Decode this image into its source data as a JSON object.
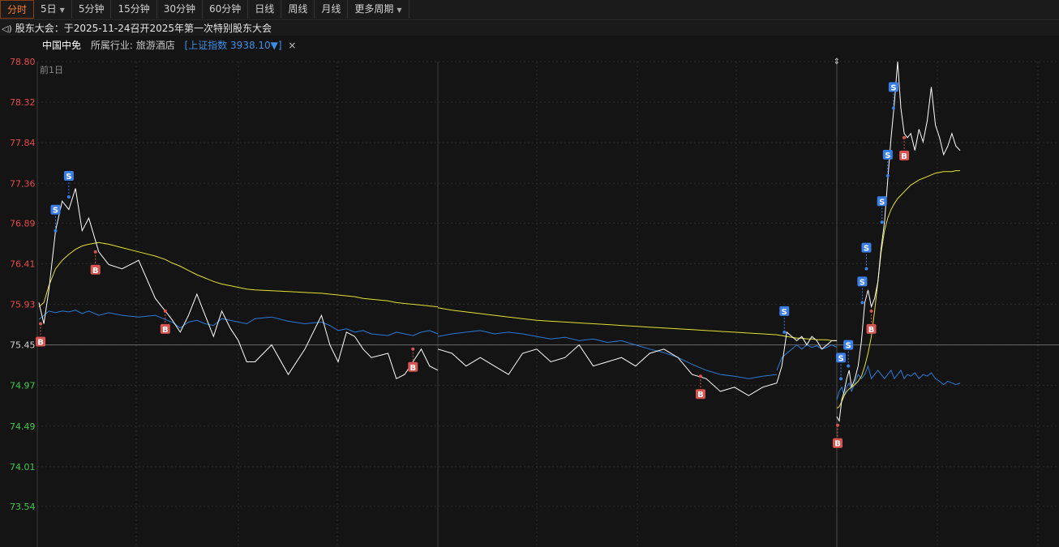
{
  "tabs": [
    {
      "label": "分时",
      "active": true,
      "dropdown": false
    },
    {
      "label": "5日",
      "active": false,
      "dropdown": true
    },
    {
      "label": "5分钟",
      "active": false,
      "dropdown": false
    },
    {
      "label": "15分钟",
      "active": false,
      "dropdown": false
    },
    {
      "label": "30分钟",
      "active": false,
      "dropdown": false
    },
    {
      "label": "60分钟",
      "active": false,
      "dropdown": false
    },
    {
      "label": "日线",
      "active": false,
      "dropdown": false
    },
    {
      "label": "周线",
      "active": false,
      "dropdown": false
    },
    {
      "label": "月线",
      "active": false,
      "dropdown": false
    },
    {
      "label": "更多周期",
      "active": false,
      "dropdown": true
    }
  ],
  "notice": {
    "icon": "speaker-icon",
    "text": "股东大会：于2025-11-24召开2025年第一次特别股东大会"
  },
  "info": {
    "name": "中国中免",
    "industry_label": "所属行业: ",
    "industry": "旅游酒店",
    "index": "[上证指数 3938.10▼]",
    "close": "×"
  },
  "colors": {
    "price": "#ffffff",
    "avg": "#e6e032",
    "index": "#2a7bd8",
    "up": "#e84a4a",
    "down": "#3ec94e",
    "ref": "#d0d0d0",
    "buy": "#d9534f",
    "sell": "#3a7ee6",
    "grid": "#2b2b2b"
  },
  "chart_data": {
    "type": "line",
    "period_label": "前1日",
    "ref_price": 75.45,
    "ylim": [
      73.06,
      78.8
    ],
    "y_ticks": [
      "78.80",
      "78.32",
      "77.84",
      "77.36",
      "76.89",
      "76.41",
      "75.93",
      "75.45",
      "74.97",
      "74.49",
      "74.01",
      "73.54"
    ],
    "day1": {
      "x": [
        0,
        3,
        6,
        10,
        14,
        18,
        22,
        26,
        30,
        36,
        42,
        50,
        60,
        70,
        76,
        80,
        85,
        90,
        95,
        100,
        105,
        110,
        115,
        120,
        125,
        130,
        140,
        150,
        160,
        170,
        175,
        180,
        185,
        190,
        195,
        200,
        210,
        215,
        220,
        225,
        230,
        235,
        240
      ],
      "price": [
        75.95,
        75.7,
        76.1,
        76.8,
        77.15,
        77.05,
        77.3,
        76.8,
        76.95,
        76.55,
        76.4,
        76.35,
        76.45,
        76.0,
        75.85,
        75.75,
        75.6,
        75.8,
        76.05,
        75.8,
        75.55,
        75.85,
        75.65,
        75.5,
        75.25,
        75.25,
        75.45,
        75.1,
        75.4,
        75.8,
        75.45,
        75.25,
        75.6,
        75.55,
        75.4,
        75.3,
        75.35,
        75.05,
        75.1,
        75.25,
        75.4,
        75.2,
        75.15
      ],
      "avg": [
        75.9,
        75.95,
        76.15,
        76.35,
        76.45,
        76.52,
        76.58,
        76.62,
        76.64,
        76.66,
        76.64,
        76.6,
        76.55,
        76.5,
        76.46,
        76.42,
        76.38,
        76.33,
        76.28,
        76.24,
        76.2,
        76.17,
        76.15,
        76.13,
        76.11,
        76.1,
        76.09,
        76.08,
        76.07,
        76.06,
        76.05,
        76.04,
        76.03,
        76.02,
        76.0,
        75.99,
        75.97,
        75.95,
        75.94,
        75.93,
        75.92,
        75.91,
        75.9
      ],
      "index": [
        75.75,
        75.8,
        75.85,
        75.83,
        75.85,
        75.84,
        75.86,
        75.82,
        75.85,
        75.8,
        75.83,
        75.8,
        75.78,
        75.8,
        75.75,
        75.72,
        75.65,
        75.72,
        75.74,
        75.7,
        75.68,
        75.76,
        75.74,
        75.72,
        75.7,
        75.76,
        75.78,
        75.73,
        75.7,
        75.72,
        75.68,
        75.62,
        75.64,
        75.6,
        75.62,
        75.58,
        75.56,
        75.6,
        75.58,
        75.56,
        75.6,
        75.62,
        75.58
      ]
    },
    "day1b": {
      "x": [
        0,
        10,
        20,
        30,
        40,
        50,
        60,
        70,
        80,
        90,
        100,
        110,
        120,
        130,
        140,
        150,
        160,
        170,
        180,
        190,
        200,
        210,
        220,
        230,
        240
      ],
      "price": [
        75.4,
        75.35,
        75.2,
        75.3,
        75.2,
        75.1,
        75.35,
        75.4,
        75.25,
        75.3,
        75.45,
        75.2,
        75.25,
        75.3,
        75.2,
        75.35,
        75.4,
        75.3,
        75.1,
        75.05,
        74.9,
        74.95,
        74.85,
        74.95,
        75.0
      ],
      "avg": [
        75.89,
        75.86,
        75.84,
        75.82,
        75.8,
        75.78,
        75.76,
        75.74,
        75.73,
        75.72,
        75.71,
        75.7,
        75.69,
        75.68,
        75.67,
        75.66,
        75.65,
        75.64,
        75.63,
        75.62,
        75.61,
        75.6,
        75.59,
        75.58,
        75.57
      ],
      "index": [
        75.55,
        75.58,
        75.6,
        75.62,
        75.58,
        75.6,
        75.58,
        75.55,
        75.52,
        75.54,
        75.5,
        75.52,
        75.48,
        75.5,
        75.45,
        75.4,
        75.36,
        75.3,
        75.22,
        75.15,
        75.1,
        75.08,
        75.05,
        75.08,
        75.1
      ]
    },
    "day1c": {
      "x": [
        0,
        10,
        20,
        30,
        40,
        50,
        60,
        70,
        80,
        90,
        100,
        110,
        120
      ],
      "price": [
        75.0,
        75.2,
        75.6,
        75.55,
        75.5,
        75.55,
        75.45,
        75.55,
        75.5,
        75.4,
        75.45,
        75.5,
        75.5
      ],
      "avg": [
        75.57,
        75.56,
        75.55,
        75.54,
        75.53,
        75.53,
        75.52,
        75.52,
        75.51,
        75.51,
        75.51,
        75.5,
        75.5
      ],
      "index": [
        75.15,
        75.3,
        75.35,
        75.4,
        75.45,
        75.4,
        75.45,
        75.42,
        75.44,
        75.4,
        75.42,
        75.45,
        75.42
      ]
    },
    "day2": {
      "x": [
        0,
        3,
        6,
        9,
        12,
        15,
        18,
        22,
        26,
        30,
        34,
        38,
        42,
        46,
        50,
        54,
        58,
        62,
        66,
        70,
        74,
        78,
        82,
        86,
        90,
        95,
        100,
        105,
        110,
        115,
        120,
        125,
        130,
        135,
        140,
        145,
        150
      ],
      "price": [
        74.6,
        74.55,
        74.8,
        74.9,
        75.05,
        75.15,
        74.95,
        75.05,
        75.2,
        75.5,
        75.95,
        76.1,
        75.9,
        76.0,
        76.2,
        76.6,
        76.9,
        77.4,
        77.9,
        78.3,
        78.8,
        78.25,
        77.95,
        77.9,
        77.95,
        77.75,
        78.0,
        77.85,
        78.1,
        78.5,
        78.05,
        77.9,
        77.7,
        77.8,
        77.95,
        77.8,
        77.75
      ],
      "avg": [
        74.7,
        74.72,
        74.78,
        74.85,
        74.9,
        74.93,
        74.95,
        74.98,
        75.02,
        75.08,
        75.2,
        75.35,
        75.55,
        75.85,
        76.2,
        76.55,
        76.8,
        76.95,
        77.05,
        77.12,
        77.18,
        77.22,
        77.26,
        77.3,
        77.34,
        77.37,
        77.4,
        77.42,
        77.44,
        77.46,
        77.48,
        77.49,
        77.5,
        77.5,
        77.5,
        77.51,
        77.51
      ],
      "index": [
        74.8,
        74.9,
        74.95,
        74.85,
        74.95,
        75.0,
        74.9,
        75.0,
        75.1,
        75.05,
        75.1,
        75.2,
        75.05,
        75.1,
        75.15,
        75.1,
        75.05,
        75.1,
        75.15,
        75.05,
        75.1,
        75.15,
        75.05,
        75.1,
        75.08,
        75.12,
        75.05,
        75.1,
        75.08,
        75.12,
        75.05,
        75.02,
        74.98,
        75.02,
        75.0,
        74.98,
        75.0
      ]
    },
    "signals": [
      {
        "type": "B",
        "day": "day1",
        "x": 1,
        "price": 75.7
      },
      {
        "type": "S",
        "day": "day1",
        "x": 10,
        "price": 76.8
      },
      {
        "type": "S",
        "day": "day1",
        "x": 18,
        "price": 77.2
      },
      {
        "type": "B",
        "day": "day1",
        "x": 34,
        "price": 76.55
      },
      {
        "type": "B",
        "day": "day1",
        "x": 76,
        "price": 75.85
      },
      {
        "type": "B",
        "day": "day1",
        "x": 225,
        "price": 75.4
      },
      {
        "type": "B",
        "day": "day1b",
        "x": 186,
        "price": 75.08
      },
      {
        "type": "S",
        "day": "day1c",
        "x": 15,
        "price": 75.6
      },
      {
        "type": "B",
        "day": "day2",
        "x": 1,
        "price": 74.5
      },
      {
        "type": "S",
        "day": "day2",
        "x": 5,
        "price": 75.05
      },
      {
        "type": "S",
        "day": "day2",
        "x": 14,
        "price": 75.2
      },
      {
        "type": "S",
        "day": "day2",
        "x": 31,
        "price": 75.95
      },
      {
        "type": "S",
        "day": "day2",
        "x": 36,
        "price": 76.35
      },
      {
        "type": "B",
        "day": "day2",
        "x": 42,
        "price": 75.85
      },
      {
        "type": "S",
        "day": "day2",
        "x": 55,
        "price": 76.9
      },
      {
        "type": "S",
        "day": "day2",
        "x": 62,
        "price": 77.45
      },
      {
        "type": "S",
        "day": "day2",
        "x": 69,
        "price": 78.25
      },
      {
        "type": "B",
        "day": "day2",
        "x": 82,
        "price": 77.9
      }
    ]
  }
}
